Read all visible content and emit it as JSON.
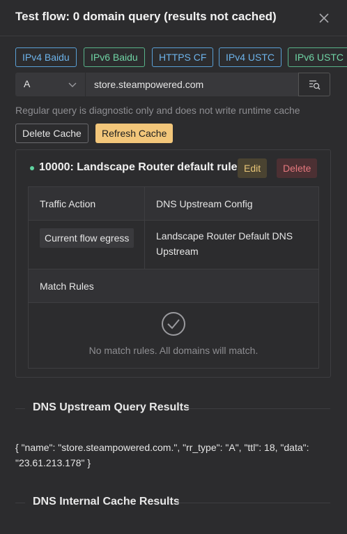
{
  "header": {
    "title": "Test flow: 0 domain query (results not cached)"
  },
  "presets": [
    {
      "label": "IPv4 Baidu",
      "color": "blue"
    },
    {
      "label": "IPv6 Baidu",
      "color": "green"
    },
    {
      "label": "HTTPS CF",
      "color": "blue"
    },
    {
      "label": "IPv4 USTC",
      "color": "blue"
    },
    {
      "label": "IPv6 USTC",
      "color": "green"
    }
  ],
  "query": {
    "record_type": "A",
    "domain": "store.steampowered.com"
  },
  "hint": "Regular query is diagnostic only and does not write runtime cache",
  "cache_buttons": {
    "delete": "Delete Cache",
    "refresh": "Refresh Cache"
  },
  "rule": {
    "title": "10000: Landscape Router default rule",
    "edit_label": "Edit",
    "delete_label": "Delete",
    "traffic_action_header": "Traffic Action",
    "dns_upstream_header": "DNS Upstream Config",
    "traffic_action_value": "Current flow egress",
    "dns_upstream_value": "Landscape Router Default DNS Upstream",
    "match_rules_header": "Match Rules",
    "empty_text": "No match rules. All domains will match."
  },
  "sections": {
    "upstream_title": "DNS Upstream Query Results",
    "upstream_result": "{ \"name\": \"store.steampowered.com.\", \"rr_type\": \"A\", \"ttl\": 18, \"data\": \"23.61.213.178\" }",
    "cache_title": "DNS Internal Cache Results"
  },
  "colors": {
    "accent": "#f2c67a",
    "blue": "#6db3ea",
    "green": "#6fd3a4",
    "danger": "#e5787e"
  }
}
